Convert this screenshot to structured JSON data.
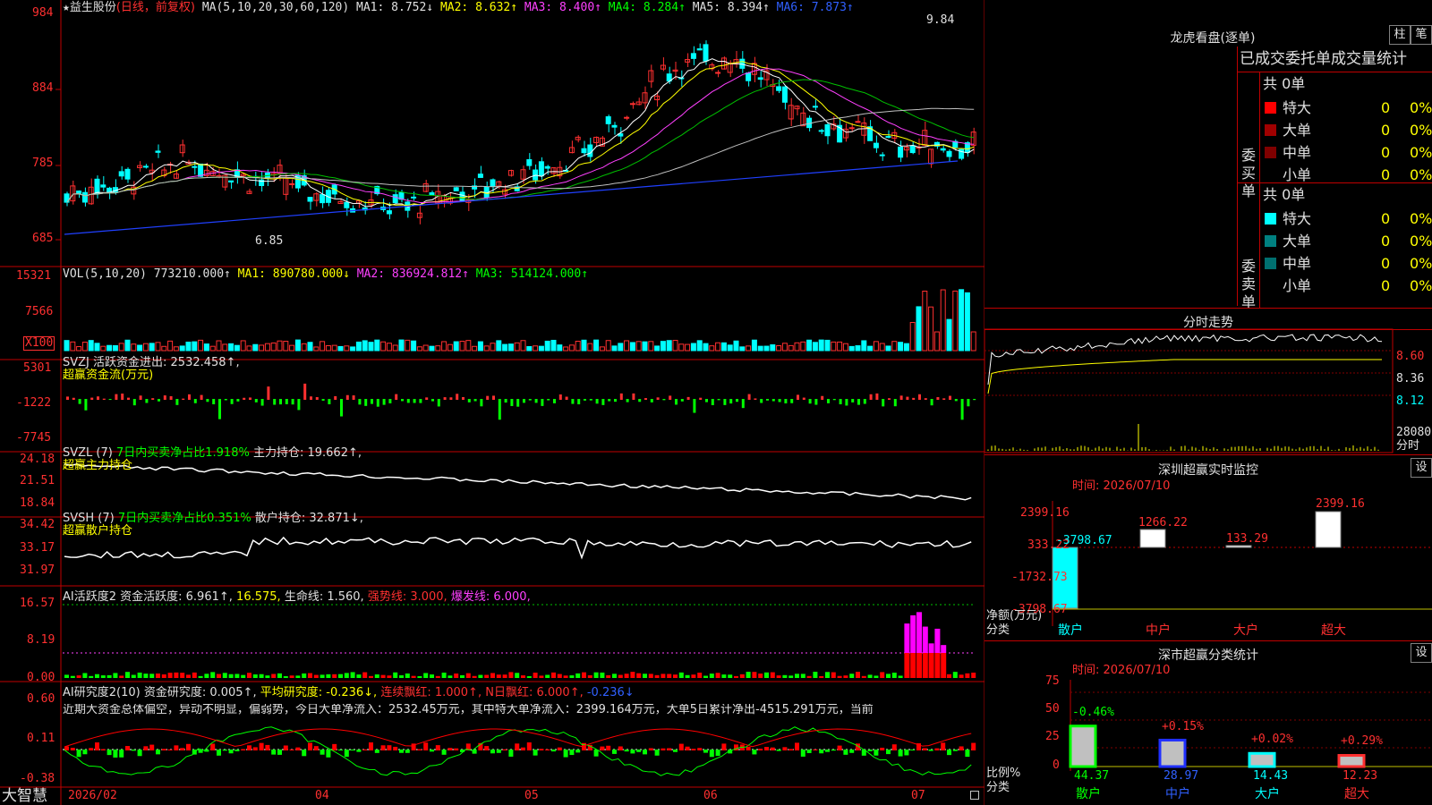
{
  "stock": {
    "star": "★",
    "name": "益生股份",
    "mode": "(日线，前复权)"
  },
  "ma_line": {
    "label": "MA(5,10,20,30,60,120)",
    "ma1": "MA1: 8.752↓",
    "ma2": "MA2: 8.632↑",
    "ma3": "MA3: 8.400↑",
    "ma4": "MA4: 8.284↑",
    "ma5": "MA5: 8.394↑",
    "ma6": "MA6: 7.873↑"
  },
  "price_axis": [
    "984",
    "884",
    "785",
    "685"
  ],
  "price_marks": {
    "high": "9.84",
    "low": "6.85"
  },
  "vol": {
    "label": "VOL(5,10,20)",
    "v": "773210.000↑",
    "ma1": "MA1: 890780.000↓",
    "ma2": "MA2: 836924.812↑",
    "ma3": "MA3: 514124.000↑",
    "axis": [
      "15321",
      "7566",
      "X100"
    ]
  },
  "svzj": {
    "l1": "SVZJ  活跃资金进出: 2532.458↑,",
    "l2": "超赢资金流(万元)",
    "axis": [
      "5301",
      "-1222",
      "-7745"
    ]
  },
  "svzl": {
    "l1a": "SVZL (7)",
    "l1b": "7日内买卖净占比1.918%",
    "l1c": "主力持仓: 19.662↑,",
    "l2": "超赢主力持仓",
    "axis": [
      "24.18",
      "21.51",
      "18.84"
    ]
  },
  "svsh": {
    "l1a": "SVSH (7)",
    "l1b": "7日内买卖净占比0.351%",
    "l1c": "散户持仓: 32.871↓,",
    "l2": "超赢散户持仓",
    "axis": [
      "34.42",
      "33.17",
      "31.97"
    ]
  },
  "ai1": {
    "a": "AI活跃度2",
    "b": "资金活跃度: 6.961↑,",
    "c": "16.575,",
    "d": "生命线: 1.560,",
    "e": "强势线: 3.000,",
    "f": "爆发线: 6.000,",
    "axis": [
      "16.57",
      "8.19",
      "0.00"
    ]
  },
  "ai2": {
    "a": "AI研究度2(10)",
    "b": "资金研究度: 0.005↑,",
    "c": "平均研究度: -0.236↓,",
    "d": "连续飘红: 1.000↑,",
    "e": "N日飘红: 6.000↑,",
    "f": "-0.236↓",
    "desc": "近期大资金总体偏空，异动不明显，偏弱势，今日大单净流入：2532.45万元，其中特大单净流入：2399.164万元，大单5日累计净出-4515.291万元，当前",
    "axis": [
      "0.60",
      "0.11",
      "-0.38"
    ]
  },
  "bottom": {
    "brand": "大智慧",
    "dates": [
      "2026/02",
      "04",
      "05",
      "06",
      "07"
    ]
  },
  "lhb": {
    "title": "龙虎看盘(逐单)",
    "btn1": "柱",
    "btn2": "笔",
    "header": "已成交委托单成交量统计",
    "buy": {
      "side": "委买单",
      "total": "共 0单",
      "rows": [
        {
          "n": "特大",
          "v": "0",
          "p": "0%",
          "c": "#ff0000"
        },
        {
          "n": "大单",
          "v": "0",
          "p": "0%",
          "c": "#a00000"
        },
        {
          "n": "中单",
          "v": "0",
          "p": "0%",
          "c": "#800000"
        },
        {
          "n": "小单",
          "v": "0",
          "p": "0%",
          "c": "#000000"
        }
      ]
    },
    "sell": {
      "side": "委卖单",
      "total": "共 0单",
      "rows": [
        {
          "n": "特大",
          "v": "0",
          "p": "0%",
          "c": "#00ffff"
        },
        {
          "n": "大单",
          "v": "0",
          "p": "0%",
          "c": "#008080"
        },
        {
          "n": "中单",
          "v": "0",
          "p": "0%",
          "c": "#007070"
        },
        {
          "n": "小单",
          "v": "0",
          "p": "0%",
          "c": "#000000"
        }
      ]
    }
  },
  "fenshi": {
    "title": "分时走势",
    "axis": [
      "8.60",
      "8.36",
      "8.12"
    ],
    "vol_label": "28080",
    "vol_unit": "分时"
  },
  "szmon": {
    "title": "深圳超赢实时监控",
    "btn": "设",
    "time": "时间: 2026/07/10",
    "axis": [
      "2399.16",
      "333.22",
      "-1732.73",
      "-3798.67"
    ],
    "ylabel1": "净额(万元)",
    "ylabel2": "分类",
    "cats": [
      "散户",
      "中户",
      "大户",
      "超大"
    ],
    "vals": [
      "-3798.67",
      "1266.22",
      "133.29",
      "2399.16"
    ]
  },
  "szcls": {
    "title": "深市超赢分类统计",
    "btn": "设",
    "time": "时间: 2026/07/10",
    "axis": [
      "75",
      "50",
      "25",
      "0"
    ],
    "ylabel1": "比例%",
    "ylabel2": "分类",
    "cats": [
      "散户",
      "中户",
      "大户",
      "超大"
    ],
    "pct": [
      "44.37",
      "28.97",
      "14.43",
      "12.23"
    ],
    "chg": [
      "-0.46%",
      "+0.15%",
      "+0.02%",
      "+0.29%"
    ]
  },
  "colors": {
    "up": "#ff3030",
    "down": "#00ffff",
    "grid": "#c00000"
  }
}
